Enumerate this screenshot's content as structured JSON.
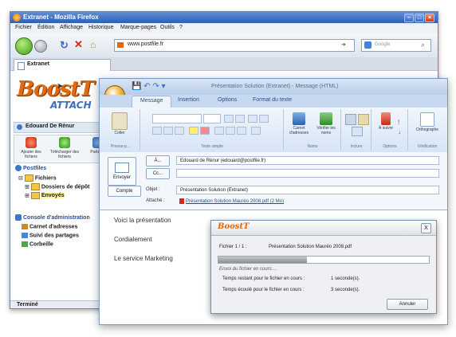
{
  "browser": {
    "title": "Extranet - Mozilla Firefox",
    "menu": [
      "Fichier",
      "Édition",
      "Affichage",
      "Historique",
      "Marque-pages",
      "Outils",
      "?"
    ],
    "url": "www.postfile.fr",
    "search_placeholder": "Google",
    "tab": "Extranet",
    "status": "Terminé"
  },
  "app": {
    "logo_main": "BoostT",
    "logo_sub": "ATTACH",
    "user": "Edouard De Rénur",
    "toolbar": [
      "Ajouter des fichiers",
      "Télécharger des fichiers",
      "Partager"
    ],
    "tree": {
      "root": "Postfiles",
      "fichiers": "Fichiers",
      "dossiers": "Dossiers de dépôt",
      "envoyes": "Envoyés",
      "console": "Console d'administration",
      "carnet": "Carnet d'adresses",
      "suivi": "Suivi des partages",
      "corbeille": "Corbeille"
    }
  },
  "mail": {
    "title": "Présentation Solution (Extranet) - Message (HTML)",
    "tabs": [
      "Message",
      "Insertion",
      "Options",
      "Format du texte"
    ],
    "groups": [
      "Presse-p...",
      "Texte simple",
      "Noms",
      "Inclure",
      "Options",
      "Vérification"
    ],
    "ribbon_buttons": {
      "coller": "Coller",
      "carnet": "Carnet d'adresses",
      "verifier": "Vérifier les noms",
      "suivi": "À suivre",
      "orthographe": "Orthographe"
    },
    "send": "Envoyer",
    "to_btn": "À...",
    "cc_btn": "Cc...",
    "account_btn": "Compte",
    "to_value": "Edouard de Rénur (edouard@postfile.fr)",
    "subject_label": "Objet :",
    "subject_value": "Présentation Solution (Extranet)",
    "attach_label": "Attaché :",
    "attach_value": "Présentation Solution Mauréo 2008.pdf (2 Mo)",
    "body": [
      "Voici la présentation",
      "Cordialement",
      "Le service Marketing"
    ]
  },
  "dialog": {
    "logo": "BoostT",
    "close": "X",
    "file_label": "Fichier 1 / 1 :",
    "file_name": "Présentation Solution Mauréo 2008.pdf",
    "sending": "Envoi du fichier en cours ...",
    "remaining_label": "Temps restant pour le fichier en cours :",
    "remaining_value": "1 seconde(s).",
    "elapsed_label": "Temps écoulé pour le fichier en cours :",
    "elapsed_value": "3 seconde(s).",
    "cancel": "Annuler",
    "progress": 0.42
  },
  "colors": {
    "accent": "#e36a0c",
    "title_blue": "#2f5fb5"
  }
}
